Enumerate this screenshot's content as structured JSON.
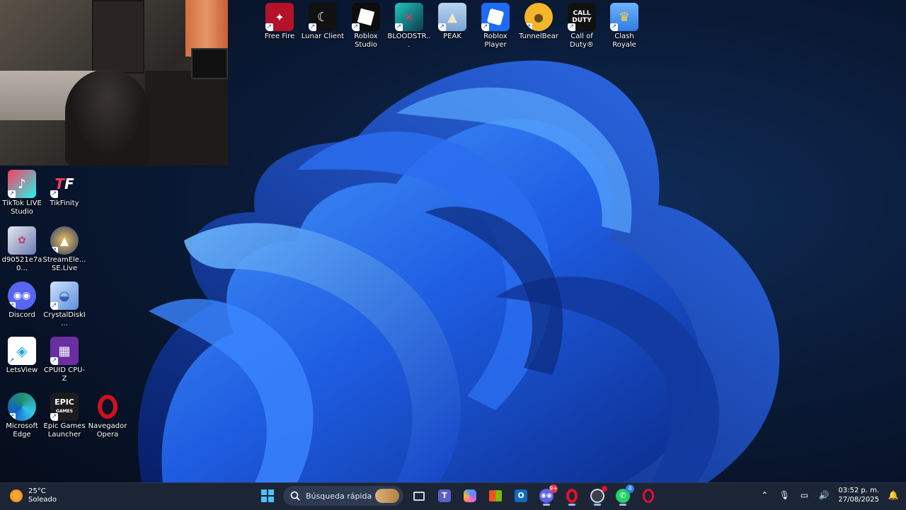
{
  "desktop": {
    "top_icons": [
      {
        "label": "Free Fire",
        "icon": "free-fire-icon",
        "color": "#b3122a"
      },
      {
        "label": "Lunar Client",
        "icon": "lunar-client-icon",
        "color": "#111111"
      },
      {
        "label": "Roblox Studio",
        "icon": "roblox-studio-icon",
        "color": "#0d0d0d"
      },
      {
        "label": "BLOODSTR...",
        "icon": "bloodstrike-icon",
        "color": "#1b7b7f"
      },
      {
        "label": "PEAK",
        "icon": "peak-icon",
        "color": "#8ab6de"
      },
      {
        "label": "Roblox Player",
        "icon": "roblox-player-icon",
        "color": "#1d6bf2"
      },
      {
        "label": "TunnelBear",
        "icon": "tunnelbear-icon",
        "color": "#f3b52a"
      },
      {
        "label": "Call of Duty®",
        "icon": "call-of-duty-icon",
        "color": "#111111"
      },
      {
        "label": "Clash Royale",
        "icon": "clash-royale-icon",
        "color": "#2f7de2"
      }
    ],
    "left_icons": [
      {
        "label": "TikTok LIVE Studio",
        "icon": "tiktok-live-studio-icon",
        "color": "#e02d4d"
      },
      {
        "label": "TikFinity",
        "icon": "tikfinity-icon",
        "color": "#1a2340"
      },
      {
        "label": "d90521e7a0...",
        "icon": "image-file-icon",
        "color": "#3b4b7a"
      },
      {
        "label": "StreamEle... SE.Live",
        "icon": "streamelements-icon",
        "color": "#2a3d66"
      },
      {
        "label": "Discord",
        "icon": "discord-icon",
        "color": "#5865f2"
      },
      {
        "label": "CrystalDiskI...",
        "icon": "crystaldiskinfo-icon",
        "color": "#5b8ed8"
      },
      {
        "label": "LetsView",
        "icon": "letsview-icon",
        "color": "#ffffff"
      },
      {
        "label": "CPUID CPU-Z",
        "icon": "cpu-z-icon",
        "color": "#6a2fa0"
      },
      {
        "label": "Microsoft Edge",
        "icon": "edge-icon",
        "color": "#1e8f6a"
      },
      {
        "label": "Epic Games Launcher",
        "icon": "epic-games-icon",
        "color": "#1c1c1c"
      },
      {
        "label": "Navegador Opera",
        "icon": "opera-icon",
        "color": "#d0101e"
      }
    ]
  },
  "taskbar": {
    "weather": {
      "temp": "25°C",
      "condition": "Soleado"
    },
    "search_placeholder": "Búsqueda rápida",
    "apps": [
      {
        "name": "task-view",
        "color": "#cfd6e4"
      },
      {
        "name": "teams",
        "color": "#5b5fc7"
      },
      {
        "name": "copilot",
        "color": "#3aa0ff"
      },
      {
        "name": "microsoft-store",
        "color": "#2d7df6"
      },
      {
        "name": "outlook",
        "color": "#0f6cbd"
      },
      {
        "name": "discord",
        "color": "#5865f2",
        "badge": "9+"
      },
      {
        "name": "opera",
        "color": "#e0102e"
      },
      {
        "name": "obs",
        "color": "#3a3f4b"
      },
      {
        "name": "whatsapp",
        "color": "#25d366",
        "badge": "4"
      },
      {
        "name": "opera-gx",
        "color": "#e0102e"
      }
    ],
    "clock": {
      "time": "03:52 p. m.",
      "date": "27/08/2025"
    }
  }
}
